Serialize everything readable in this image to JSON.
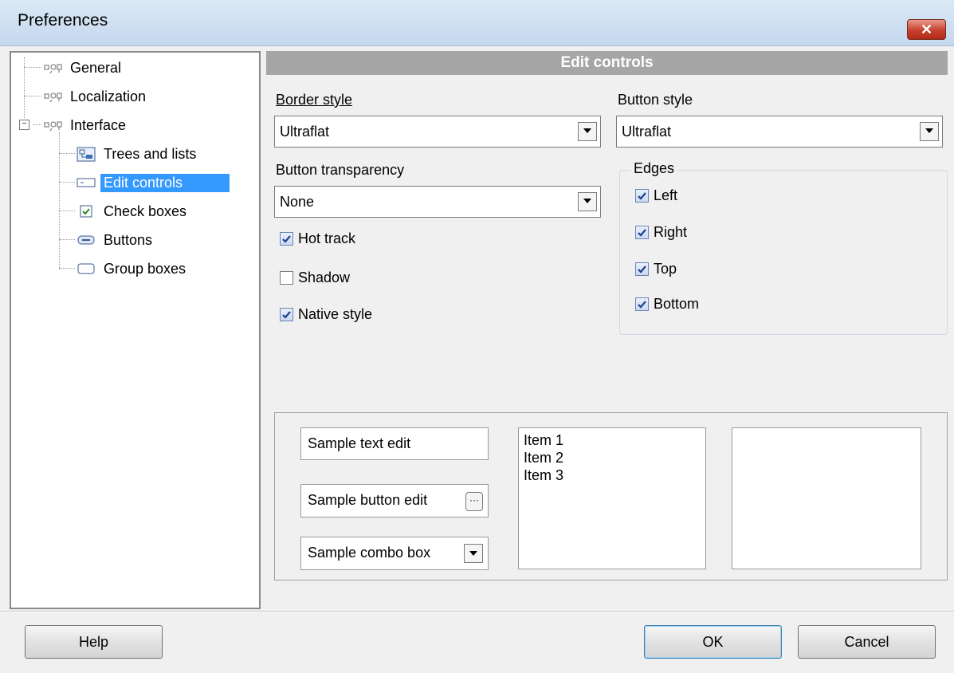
{
  "window": {
    "title": "Preferences",
    "close_glyph": "✕"
  },
  "tree": {
    "items": [
      {
        "label": "General",
        "icon": "settings-node-icon"
      },
      {
        "label": "Localization",
        "icon": "settings-node-icon"
      },
      {
        "label": "Interface",
        "icon": "settings-node-icon",
        "expander": "−"
      },
      {
        "label": "Trees and lists",
        "icon": "tree-list-icon"
      },
      {
        "label": "Edit controls",
        "icon": "edit-control-icon",
        "selected": true
      },
      {
        "label": "Check boxes",
        "icon": "checkbox-icon"
      },
      {
        "label": "Buttons",
        "icon": "button-icon"
      },
      {
        "label": "Group boxes",
        "icon": "group-box-icon"
      }
    ]
  },
  "section": {
    "title": "Edit controls"
  },
  "form": {
    "border_style": {
      "label": "Border style",
      "value": "Ultraflat"
    },
    "button_style": {
      "label": "Button style",
      "value": "Ultraflat"
    },
    "button_transparency": {
      "label": "Button transparency",
      "value": "None"
    },
    "hot_track": {
      "label": "Hot track",
      "checked": true
    },
    "shadow": {
      "label": "Shadow",
      "checked": false
    },
    "native_style": {
      "label": "Native style",
      "checked": true
    },
    "edges": {
      "legend": "Edges",
      "left": {
        "label": "Left",
        "checked": true
      },
      "right": {
        "label": "Right",
        "checked": true
      },
      "top": {
        "label": "Top",
        "checked": true
      },
      "bottom": {
        "label": "Bottom",
        "checked": true
      }
    }
  },
  "samples": {
    "text_edit": "Sample text edit",
    "button_edit": "Sample button edit",
    "button_edit_glyph": "···",
    "combo_box": "Sample combo box",
    "list_items": [
      "Item 1",
      "Item 2",
      "Item 3"
    ]
  },
  "buttons": {
    "help": "Help",
    "ok": "OK",
    "cancel": "Cancel"
  },
  "colors": {
    "selection": "#3399ff",
    "section_header": "#a6a6a6",
    "close_button": "#c7412d"
  }
}
